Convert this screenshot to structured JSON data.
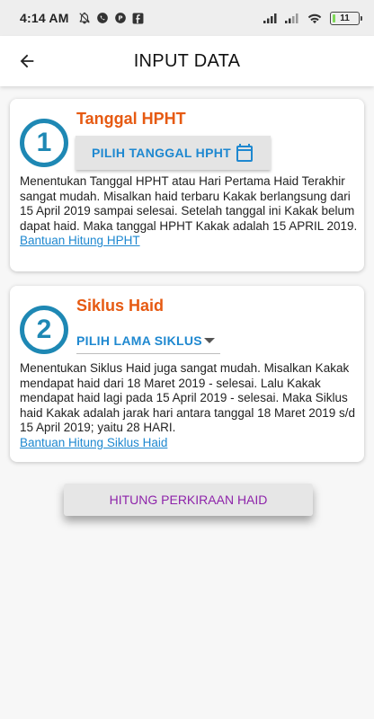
{
  "status_bar": {
    "time": "4:14 AM",
    "battery": "11",
    "battery_level": 0.11,
    "icons": [
      "bell-off-icon",
      "whatsapp-icon",
      "app-icon",
      "facebook-icon",
      "signal-icon",
      "signal-icon",
      "wifi-icon",
      "battery-icon"
    ]
  },
  "app_bar": {
    "title": "INPUT DATA",
    "back_icon": "arrow-left-icon"
  },
  "cards": [
    {
      "number": "1",
      "title": "Tanggal HPHT",
      "button_label": "PILIH TANGGAL HPHT",
      "button_icon": "calendar-icon",
      "description": "Menentukan Tanggal HPHT atau Hari Pertama Haid Terakhir sangat mudah. Misalkan haid terbaru Kakak berlangsung dari 15 April 2019 sampai selesai. Setelah tanggal ini Kakak belum dapat haid. Maka tanggal HPHT Kakak adalah 15 APRIL 2019.",
      "help_link": "Bantuan Hitung HPHT"
    },
    {
      "number": "2",
      "title": "Siklus Haid",
      "select_label": "PILIH LAMA SIKLUS",
      "select_icon": "dropdown-arrow-icon",
      "description": "Menentukan Siklus Haid juga sangat mudah. Misalkan Kakak mendapat haid dari 18 Maret 2019 - selesai. Lalu Kakak mendapat haid lagi pada 15 April 2019 - selesai. Maka Siklus haid Kakak adalah jarak hari antara tanggal 18 Maret 2019 s/d 15 April 2019; yaitu 28 HARI.",
      "help_link": "Bantuan Hitung Siklus Haid"
    }
  ],
  "calculate_button": "HITUNG PERKIRAAN HAID",
  "colors": {
    "accent_blue": "#1e88d0",
    "circle_blue": "#1e88b4",
    "title_orange": "#e65a12",
    "calc_purple": "#8e24aa"
  }
}
